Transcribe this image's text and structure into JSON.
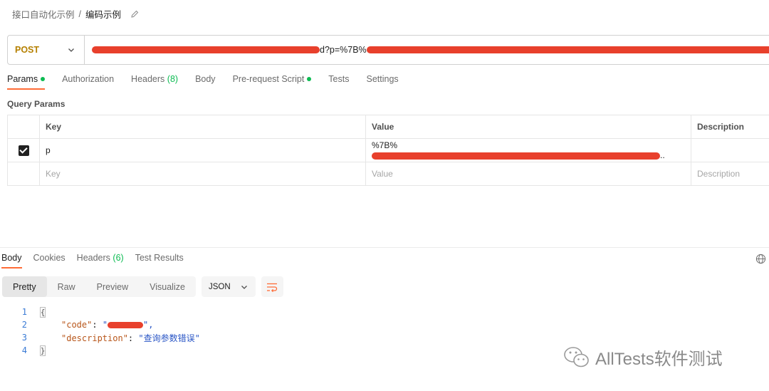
{
  "breadcrumb": {
    "parent": "接口自动化示例",
    "separator": "/",
    "current": "编码示例"
  },
  "request": {
    "method": "POST",
    "url_visible_fragment": "d?p=%7B%"
  },
  "request_tabs": [
    {
      "label": "Params",
      "dot": true
    },
    {
      "label": "Authorization"
    },
    {
      "label": "Headers",
      "count": "(8)"
    },
    {
      "label": "Body"
    },
    {
      "label": "Pre-request Script",
      "dot": true
    },
    {
      "label": "Tests"
    },
    {
      "label": "Settings"
    }
  ],
  "query_params": {
    "title": "Query Params",
    "headers": {
      "key": "Key",
      "value": "Value",
      "description": "Description"
    },
    "rows": [
      {
        "key": "p",
        "value_prefix": "%7B%",
        "value_suffix": "..",
        "checked": true
      }
    ],
    "placeholders": {
      "key": "Key",
      "value": "Value",
      "description": "Description"
    }
  },
  "response_tabs": [
    {
      "label": "Body"
    },
    {
      "label": "Cookies"
    },
    {
      "label": "Headers",
      "count": "(6)"
    },
    {
      "label": "Test Results"
    }
  ],
  "view_modes": [
    "Pretty",
    "Raw",
    "Preview",
    "Visualize"
  ],
  "format": "JSON",
  "code": {
    "line_numbers": [
      "1",
      "2",
      "3",
      "4"
    ],
    "open_brace": "{",
    "close_brace": "}",
    "key1": "\"code\"",
    "colon": ": ",
    "val1_open": "\"",
    "val1_close": "\",",
    "key2": "\"description\"",
    "val2": "\"查询参数错误\""
  },
  "watermark": "AllTests软件测试",
  "colors": {
    "accent": "#ff6c37",
    "method": "#b58000",
    "green": "#0cbb52",
    "redaction": "#e8402c"
  },
  "icons": [
    "edit-icon",
    "chevron-down-icon",
    "globe-icon",
    "wrap-lines-icon",
    "wechat-icon"
  ]
}
